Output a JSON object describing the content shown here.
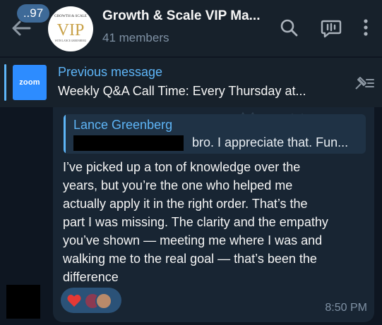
{
  "header": {
    "unread_count": "..97",
    "title": "Growth & Scale VIP Ma...",
    "members": "41 members",
    "avatar_text": {
      "top": "GROWTH & SCALE",
      "logo": "VIP",
      "bottom": "WITH LANCE GREENBERG"
    },
    "icons": [
      "back-arrow-icon",
      "search-icon",
      "live-stream-icon",
      "more-vertical-icon"
    ]
  },
  "pinned": {
    "label": "Previous message",
    "text": "Weekly Q&A Call Time: Every Thursday at...",
    "thumb_text": "zoom",
    "thumb_color": "#2d8cff"
  },
  "message": {
    "reply": {
      "author": "Lance Greenberg",
      "text": "bro. I appreciate that. Fun..."
    },
    "lines": [
      "I’ve picked up a ton of knowledge over the",
      "years, but you’re the one who helped me",
      "actually apply it in the right order. That’s the",
      "part I was missing. The clarity and the empathy",
      "you’ve shown — meeting me where I was and",
      "walking me to the real goal — that’s been the",
      "difference"
    ],
    "time": "8:50 PM",
    "reaction": "heart"
  },
  "colors": {
    "background": "#0e1621",
    "header": "#17212b",
    "bubble": "#182533",
    "accent": "#5eb5f7",
    "reaction_pill": "#2b5278",
    "heart": "#e53935"
  }
}
